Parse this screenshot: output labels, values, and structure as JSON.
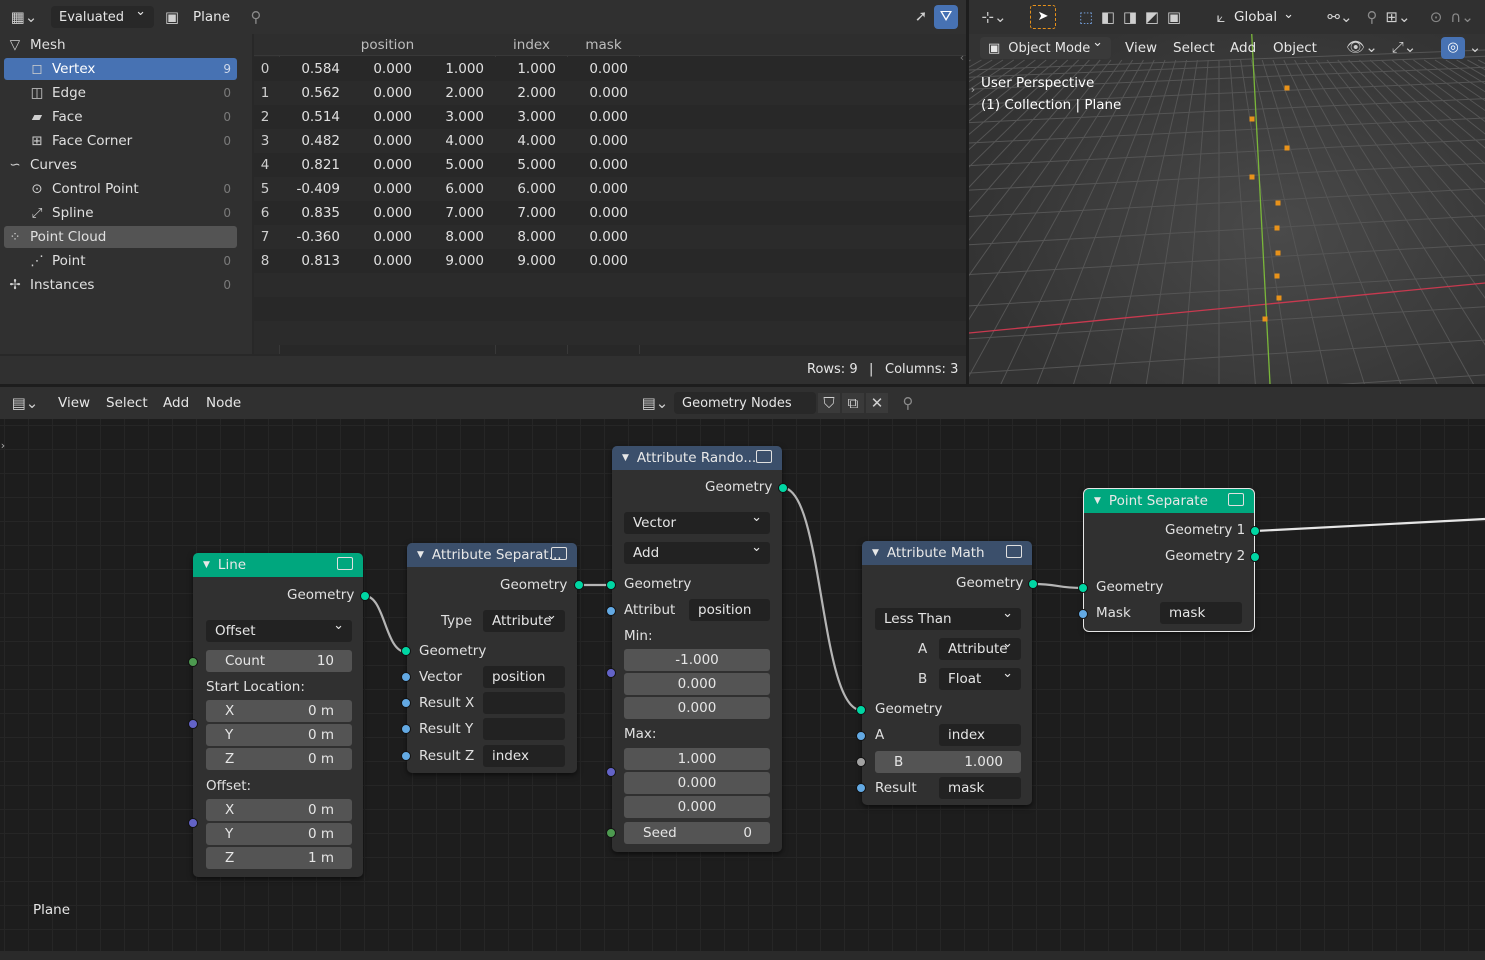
{
  "spreadsheet": {
    "header": {
      "mode": "Evaluated",
      "object": "Plane"
    },
    "tree": [
      {
        "label": "Mesh",
        "count": "",
        "indent": 0,
        "icon": "▽"
      },
      {
        "label": "Vertex",
        "count": "9",
        "indent": 1,
        "icon": "◻",
        "selected": true
      },
      {
        "label": "Edge",
        "count": "0",
        "indent": 1,
        "icon": "◫"
      },
      {
        "label": "Face",
        "count": "0",
        "indent": 1,
        "icon": "▰"
      },
      {
        "label": "Face Corner",
        "count": "0",
        "indent": 1,
        "icon": "⊞"
      },
      {
        "label": "Curves",
        "count": "",
        "indent": 0,
        "icon": "∽"
      },
      {
        "label": "Control Point",
        "count": "0",
        "indent": 1,
        "icon": "⊙"
      },
      {
        "label": "Spline",
        "count": "0",
        "indent": 1,
        "icon": "⤢"
      },
      {
        "label": "Point Cloud",
        "count": "",
        "indent": 0,
        "icon": "⁘",
        "highlight": true
      },
      {
        "label": "Point",
        "count": "0",
        "indent": 1,
        "icon": "⋰"
      },
      {
        "label": "Instances",
        "count": "0",
        "indent": 0,
        "icon": "✢"
      }
    ],
    "columns": [
      "position",
      "index",
      "mask"
    ],
    "rows": [
      {
        "i": "0",
        "px": "0.584",
        "py": "0.000",
        "pz": "1.000",
        "index": "1.000",
        "mask": "0.000"
      },
      {
        "i": "1",
        "px": "0.562",
        "py": "0.000",
        "pz": "2.000",
        "index": "2.000",
        "mask": "0.000"
      },
      {
        "i": "2",
        "px": "0.514",
        "py": "0.000",
        "pz": "3.000",
        "index": "3.000",
        "mask": "0.000"
      },
      {
        "i": "3",
        "px": "0.482",
        "py": "0.000",
        "pz": "4.000",
        "index": "4.000",
        "mask": "0.000"
      },
      {
        "i": "4",
        "px": "0.821",
        "py": "0.000",
        "pz": "5.000",
        "index": "5.000",
        "mask": "0.000"
      },
      {
        "i": "5",
        "px": "-0.409",
        "py": "0.000",
        "pz": "6.000",
        "index": "6.000",
        "mask": "0.000"
      },
      {
        "i": "6",
        "px": "0.835",
        "py": "0.000",
        "pz": "7.000",
        "index": "7.000",
        "mask": "0.000"
      },
      {
        "i": "7",
        "px": "-0.360",
        "py": "0.000",
        "pz": "8.000",
        "index": "8.000",
        "mask": "0.000"
      },
      {
        "i": "8",
        "px": "0.813",
        "py": "0.000",
        "pz": "9.000",
        "index": "9.000",
        "mask": "0.000"
      }
    ],
    "footer": {
      "rows": "Rows: 9",
      "sep": "|",
      "columns": "Columns: 3"
    }
  },
  "viewport": {
    "orientation": "Global",
    "mode": "Object Mode",
    "menus": [
      "View",
      "Select",
      "Add",
      "Object"
    ],
    "info_line1": "User Perspective",
    "info_line2": "(1) Collection | Plane",
    "colors": {
      "accent": "#4772b3",
      "point": "#e8921a",
      "x_axis": "#c8394f",
      "y_axis": "#7ab73a"
    }
  },
  "node_editor": {
    "menus": [
      "View",
      "Select",
      "Add",
      "Node"
    ],
    "tree_name": "Geometry Nodes",
    "object_label": "Plane",
    "nodes": {
      "line": {
        "title": "Line",
        "out": "Geometry",
        "mode": "Offset",
        "count_label": "Count",
        "count": "10",
        "start": "Start Location:",
        "x": "X",
        "y": "Y",
        "z": "Z",
        "sx": "0 m",
        "sy": "0 m",
        "sz": "0 m",
        "offset": "Offset:",
        "ox": "0 m",
        "oy": "0 m",
        "oz": "1 m"
      },
      "sep": {
        "title": "Attribute Separat...",
        "out": "Geometry",
        "type_label": "Type",
        "type": "Attribute",
        "geo": "Geometry",
        "vector": "Vector",
        "vector_val": "position",
        "rx": "Result X",
        "ry": "Result Y",
        "rz": "Result Z",
        "rz_val": "index"
      },
      "rand": {
        "title": "Attribute Rando...",
        "out": "Geometry",
        "dtype": "Vector",
        "op": "Add",
        "geo": "Geometry",
        "attr": "Attribut",
        "attr_val": "position",
        "min": "Min:",
        "min1": "-1.000",
        "min2": "0.000",
        "min3": "0.000",
        "max": "Max:",
        "max1": "1.000",
        "max2": "0.000",
        "max3": "0.000",
        "seed": "Seed",
        "seed_val": "0"
      },
      "math": {
        "title": "Attribute Math",
        "out": "Geometry",
        "op": "Less Than",
        "a": "A",
        "a_type": "Attribute",
        "b": "B",
        "b_type": "Float",
        "geo": "Geometry",
        "a_val": "index",
        "b_val": "1.000",
        "result": "Result",
        "result_val": "mask"
      },
      "psep": {
        "title": "Point Separate",
        "g1": "Geometry 1",
        "g2": "Geometry 2",
        "geo": "Geometry",
        "mask": "Mask",
        "mask_val": "mask"
      }
    }
  }
}
